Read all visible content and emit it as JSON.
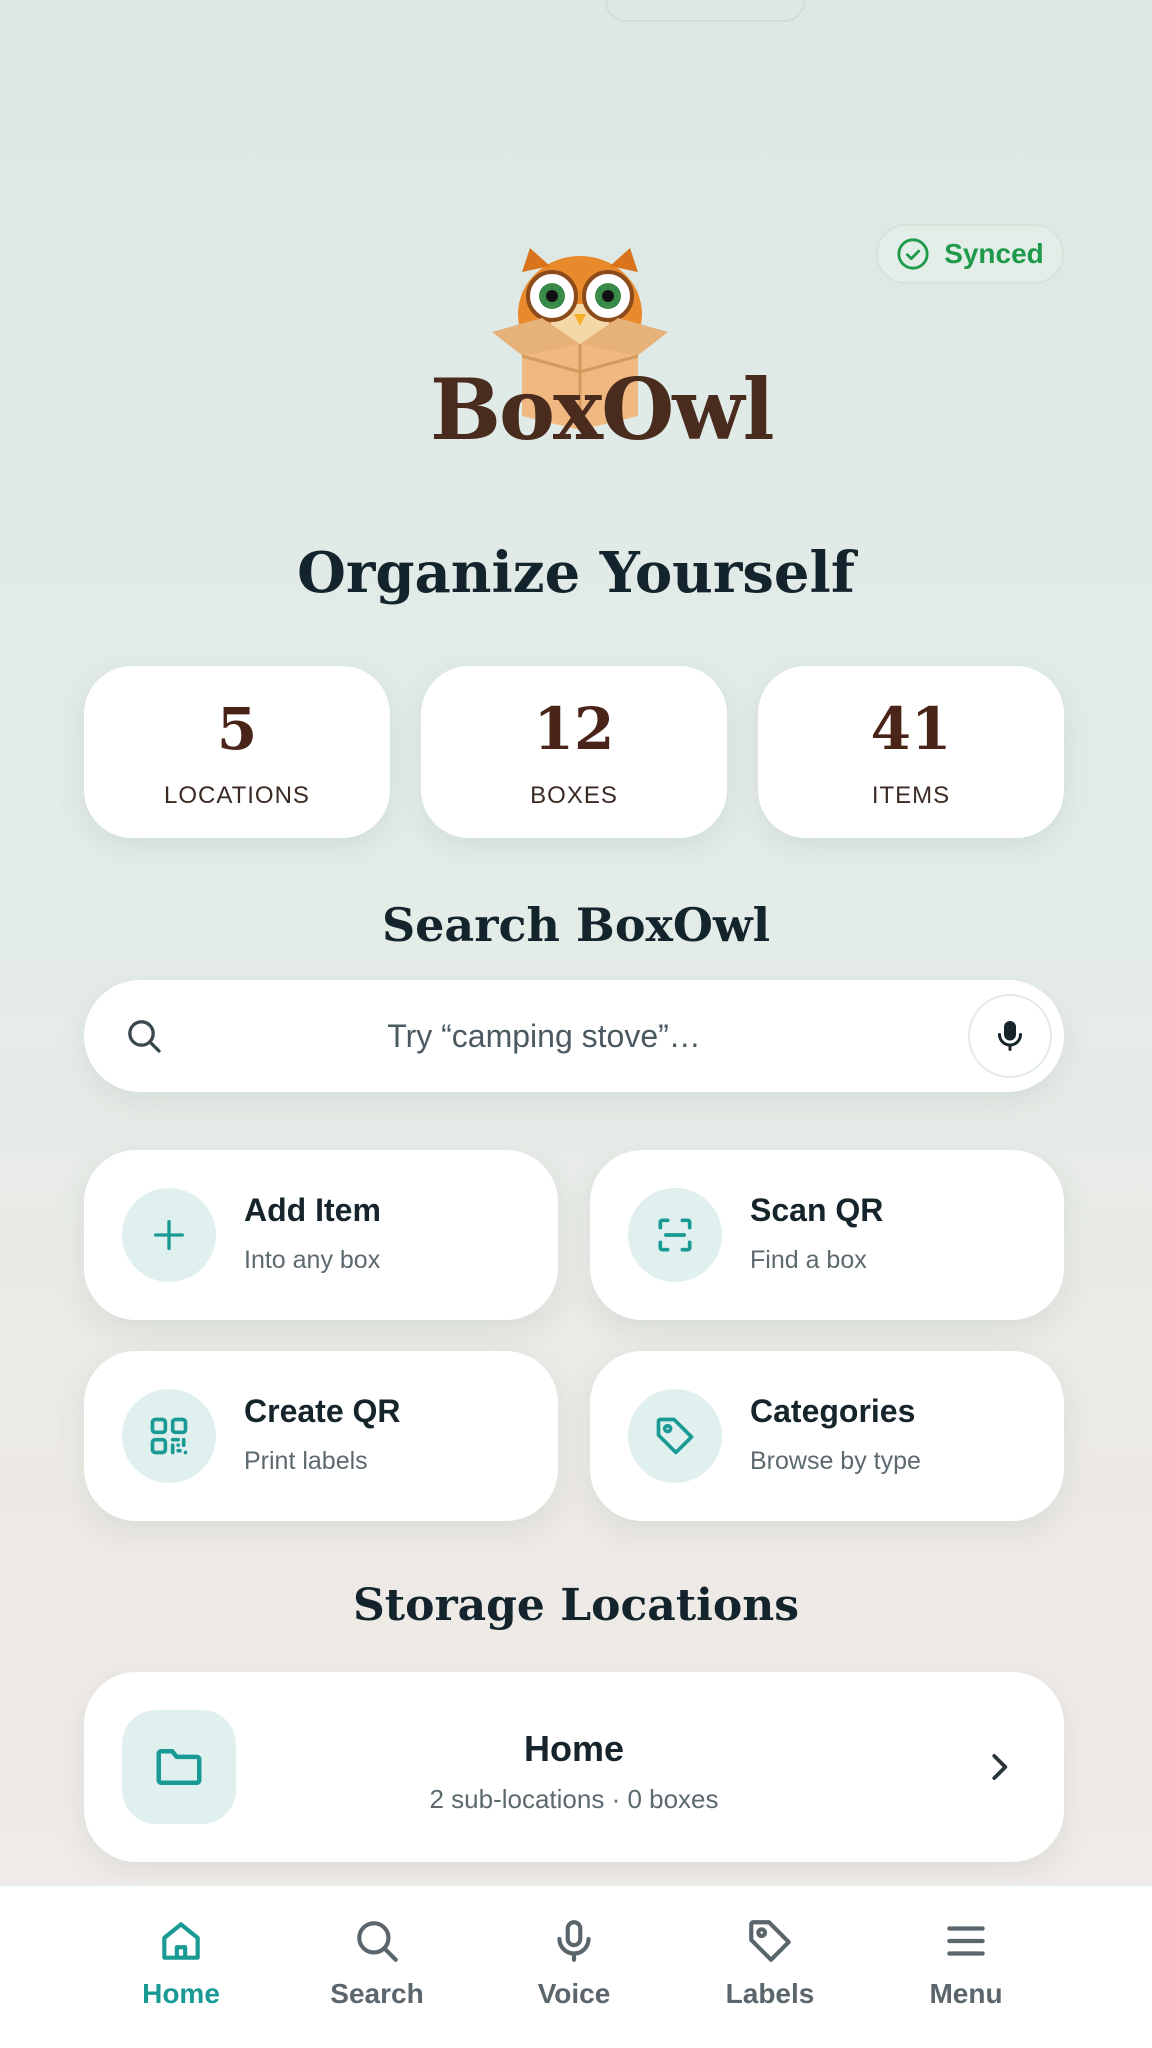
{
  "status": {
    "sync_label": "Synced",
    "accent": "#1f9a4a"
  },
  "brand": {
    "logo_text": "BoxOwl",
    "logo_icon": "owl-in-box-logo"
  },
  "headline": "Organize Yourself",
  "stats": [
    {
      "value": "5",
      "label": "LOCATIONS"
    },
    {
      "value": "12",
      "label": "BOXES"
    },
    {
      "value": "41",
      "label": "ITEMS"
    }
  ],
  "search": {
    "title": "Search BoxOwl",
    "placeholder": "Try “camping stove”…",
    "icon": "search-icon",
    "mic_icon": "microphone-icon"
  },
  "actions": [
    {
      "title": "Add Item",
      "subtitle": "Into any box",
      "icon": "plus-icon"
    },
    {
      "title": "Scan QR",
      "subtitle": "Find a box",
      "icon": "scan-icon"
    },
    {
      "title": "Create QR",
      "subtitle": "Print labels",
      "icon": "qr-code-icon"
    },
    {
      "title": "Categories",
      "subtitle": "Browse by type",
      "icon": "tag-icon"
    }
  ],
  "storage": {
    "title": "Storage Locations",
    "locations": [
      {
        "name": "Home",
        "detail": "2 sub-locations · 0 boxes",
        "icon": "folder-icon"
      }
    ]
  },
  "nav": {
    "items": [
      {
        "label": "Home",
        "icon": "home-icon",
        "active": true
      },
      {
        "label": "Search",
        "icon": "search-icon"
      },
      {
        "label": "Voice",
        "icon": "microphone-icon"
      },
      {
        "label": "Labels",
        "icon": "tag-icon"
      },
      {
        "label": "Menu",
        "icon": "menu-icon"
      }
    ],
    "active_color": "#1a9a94"
  },
  "colors": {
    "teal": "#1a9a94",
    "brown": "#4a2418"
  }
}
